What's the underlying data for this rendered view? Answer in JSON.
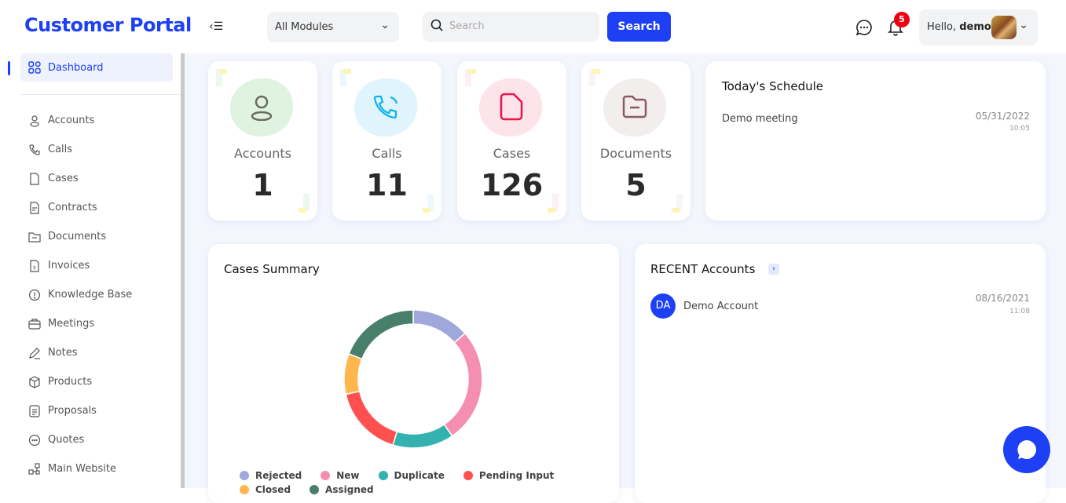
{
  "header": {
    "logo": "Customer Portal",
    "module_select": "All Modules",
    "search_placeholder": "Search",
    "search_button": "Search",
    "notification_count": "5",
    "greeting": "Hello,",
    "username": "demo"
  },
  "sidebar": {
    "active": "Dashboard",
    "items": [
      {
        "label": "Accounts",
        "icon": "user-icon"
      },
      {
        "label": "Calls",
        "icon": "phone-icon"
      },
      {
        "label": "Cases",
        "icon": "file-icon"
      },
      {
        "label": "Contracts",
        "icon": "contract-icon"
      },
      {
        "label": "Documents",
        "icon": "folder-icon"
      },
      {
        "label": "Invoices",
        "icon": "invoice-icon"
      },
      {
        "label": "Knowledge Base",
        "icon": "info-icon"
      },
      {
        "label": "Meetings",
        "icon": "briefcase-icon"
      },
      {
        "label": "Notes",
        "icon": "pencil-icon"
      },
      {
        "label": "Products",
        "icon": "box-icon"
      },
      {
        "label": "Proposals",
        "icon": "document-icon"
      },
      {
        "label": "Quotes",
        "icon": "quote-icon"
      },
      {
        "label": "Main Website",
        "icon": "sitemap-icon"
      }
    ]
  },
  "stats": [
    {
      "label": "Accounts",
      "value": "1",
      "color": "#dff3e0",
      "icon_color": "#6b6b5e"
    },
    {
      "label": "Calls",
      "value": "11",
      "color": "#dff4fc",
      "icon_color": "#14b4e8"
    },
    {
      "label": "Cases",
      "value": "126",
      "color": "#fce4ea",
      "icon_color": "#f0104a"
    },
    {
      "label": "Documents",
      "value": "5",
      "color": "#f3eeee",
      "icon_color": "#8a5a60"
    }
  ],
  "schedule": {
    "title": "Today's Schedule",
    "items": [
      {
        "name": "Demo meeting",
        "date": "05/31/2022",
        "time": "10:05"
      }
    ]
  },
  "cases_summary": {
    "title": "Cases Summary"
  },
  "recent_accounts": {
    "title": "RECENT Accounts",
    "items": [
      {
        "initials": "DA",
        "name": "Demo Account",
        "date": "08/16/2021",
        "time": "11:08"
      }
    ]
  },
  "chart_data": {
    "type": "pie",
    "donut": true,
    "title": "Cases Summary",
    "legend_position": "bottom",
    "categories": [
      "Rejected",
      "New",
      "Duplicate",
      "Pending Input",
      "Closed",
      "Assigned"
    ],
    "values": [
      17,
      34,
      18,
      21,
      12,
      24
    ],
    "colors": [
      "#9fa8da",
      "#f48fb1",
      "#33b2b0",
      "#ff5050",
      "#ffb74d",
      "#477f6a"
    ]
  }
}
